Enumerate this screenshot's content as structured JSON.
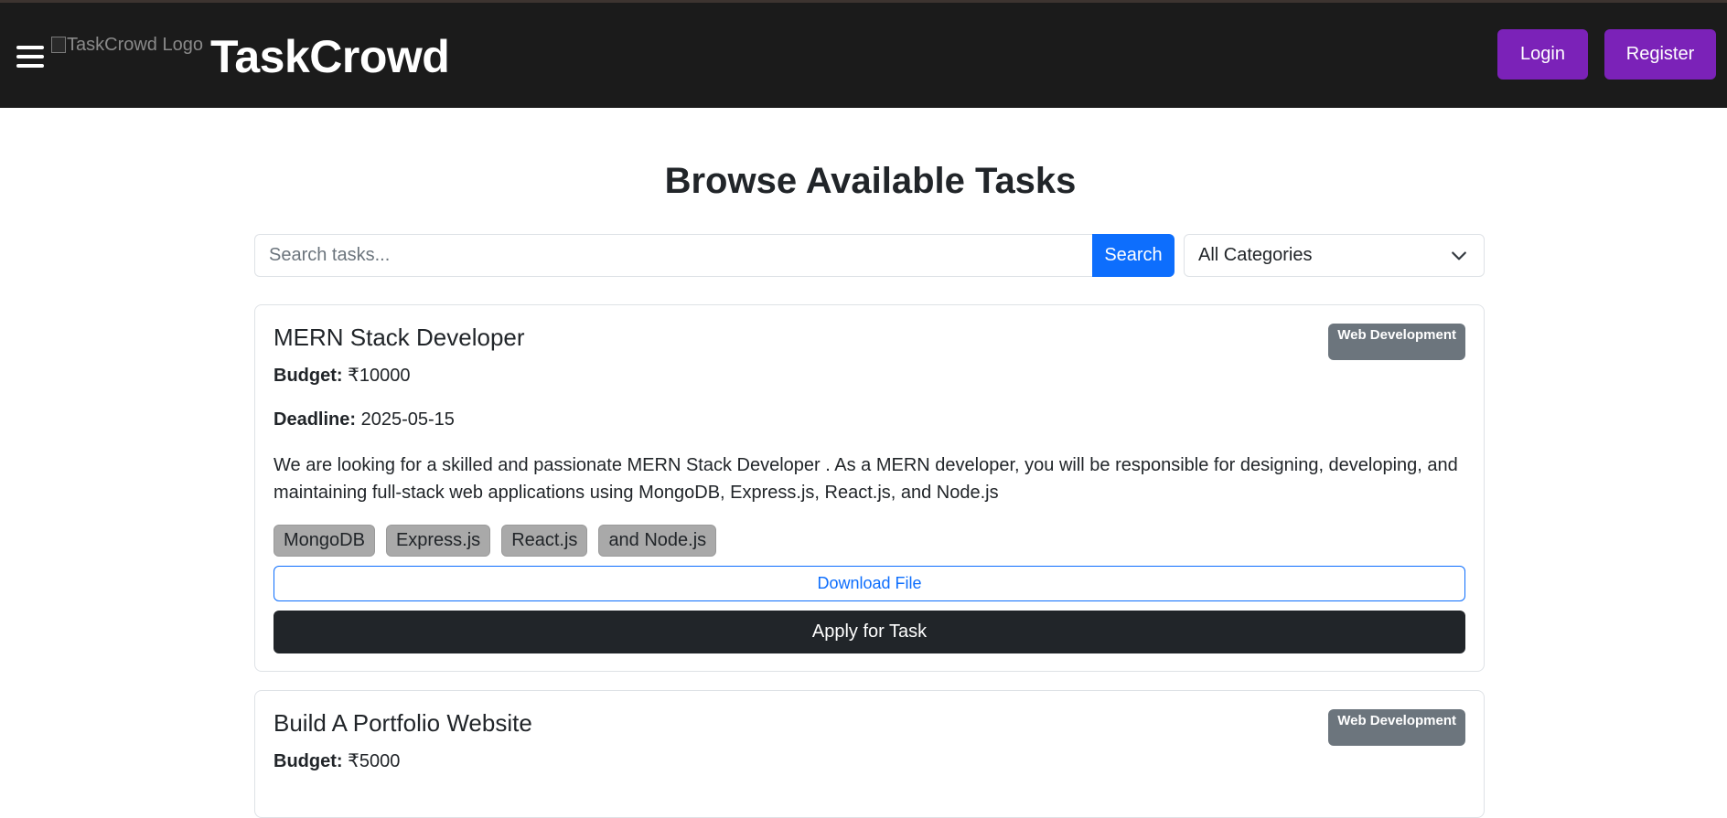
{
  "navbar": {
    "logo_alt": "TaskCrowd Logo",
    "brand": "TaskCrowd",
    "login_label": "Login",
    "register_label": "Register",
    "accent_color": "#7b22b8"
  },
  "main": {
    "title": "Browse Available Tasks",
    "search": {
      "placeholder": "Search tasks...",
      "button_label": "Search"
    },
    "category_filter": {
      "selected": "All Categories"
    }
  },
  "tasks": [
    {
      "title": "MERN Stack Developer",
      "category": "Web Development",
      "budget_label": "Budget:",
      "budget": "₹10000",
      "deadline_label": "Deadline:",
      "deadline": "2025-05-15",
      "description": "We are looking for a skilled and passionate MERN Stack Developer . As a MERN developer, you will be responsible for designing, developing, and maintaining full-stack web applications using MongoDB, Express.js, React.js, and Node.js",
      "skills": [
        "MongoDB",
        "Express.js",
        "React.js",
        "and Node.js"
      ],
      "download_label": "Download File",
      "apply_label": "Apply for Task"
    },
    {
      "title": "Build A Portfolio Website",
      "category": "Web Development",
      "budget_label": "Budget:",
      "budget": "₹5000"
    }
  ]
}
